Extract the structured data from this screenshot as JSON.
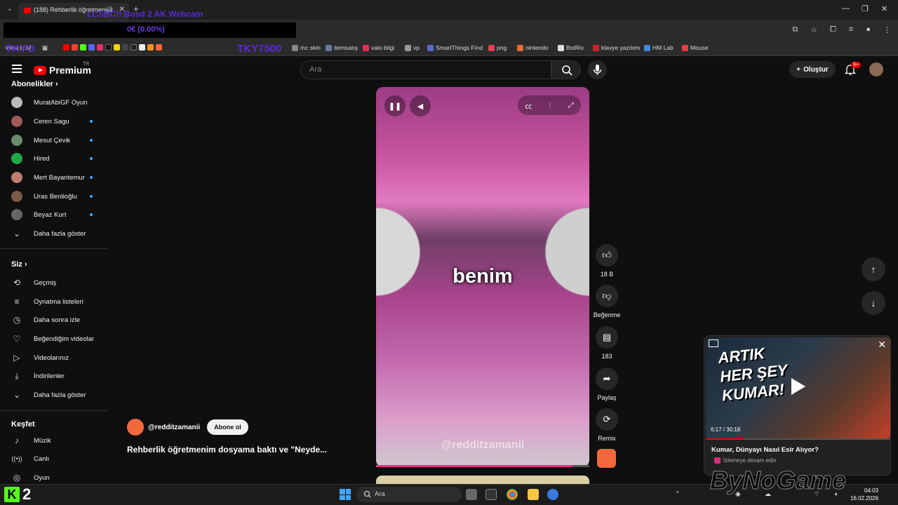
{
  "browser": {
    "tab_title": "(188) Rehberlik öğretmenim",
    "overlay_top_text": "LCSBC!! Bosd 2 AK Webcam",
    "blackbox_text": "0€ (0.00%)",
    "overlay_tags": [
      "TKYO",
      "TKY7500"
    ],
    "bookmarks": [
      {
        "label": "mc skin",
        "color": "#888"
      },
      {
        "label": "itemsatış",
        "color": "#6a7aa0"
      },
      {
        "label": "valo bilgi",
        "color": "#e03050"
      },
      {
        "label": "vp",
        "color": "#999"
      },
      {
        "label": "SmartThings Find",
        "color": "#5a6ad0"
      },
      {
        "label": "png",
        "color": "#e04050"
      },
      {
        "label": "nintendo",
        "color": "#e07030"
      },
      {
        "label": "BotRix",
        "color": "#ddd"
      },
      {
        "label": "klavye yazılımı",
        "color": "#d02030"
      },
      {
        "label": "HM Lab",
        "color": "#3a8ae0"
      },
      {
        "label": "Mouse",
        "color": "#e04040"
      }
    ],
    "bookmark_first_label": "www.ts.hr"
  },
  "header": {
    "logo_text": "Premium",
    "logo_region": "TR",
    "search_placeholder": "Ara",
    "create_label": "Oluştur",
    "notifications_badge": "9+"
  },
  "sidebar": {
    "subscriptions_title": "Abonelikler",
    "subscriptions": [
      {
        "label": "MuratAbiGF Oyun",
        "color": "#bbb",
        "dot": false
      },
      {
        "label": "Ceren Sagu",
        "color": "#a05a5a",
        "dot": true
      },
      {
        "label": "Mesut Çevik",
        "color": "#6a8a6a",
        "dot": true
      },
      {
        "label": "Hired",
        "color": "#1faa4a",
        "dot": true
      },
      {
        "label": "Mert Bayantemur",
        "color": "#c08070",
        "dot": true
      },
      {
        "label": "Uras Benlioğlu",
        "color": "#7a5a4a",
        "dot": true
      },
      {
        "label": "Beyaz Kurt",
        "color": "#666",
        "dot": true
      }
    ],
    "subs_more": "Daha fazla göster",
    "you_title": "Siz",
    "you_items": [
      {
        "label": "Geçmiş",
        "icon": "history-icon",
        "glyph": "⟲"
      },
      {
        "label": "Oynatma listeleri",
        "icon": "playlist-icon",
        "glyph": "≡"
      },
      {
        "label": "Daha sonra izle",
        "icon": "clock-icon",
        "glyph": "◷"
      },
      {
        "label": "Beğendiğim videolar",
        "icon": "thumbs-up-icon",
        "glyph": "👍"
      },
      {
        "label": "Videolarınız",
        "icon": "video-icon",
        "glyph": "▷"
      },
      {
        "label": "İndirilenler",
        "icon": "download-icon",
        "glyph": "⤓"
      }
    ],
    "you_more": "Daha fazla göster",
    "explore_title": "Keşfet",
    "explore_items": [
      {
        "label": "Müzik",
        "icon": "music-icon",
        "glyph": "♪"
      },
      {
        "label": "Canlı",
        "icon": "live-icon",
        "glyph": "((•))"
      },
      {
        "label": "Oyun",
        "icon": "gaming-icon",
        "glyph": "🎮"
      }
    ]
  },
  "short": {
    "caption": "benim",
    "watermark": "@redditzamanii",
    "channel": "@redditzamanii",
    "subscribe_label": "Abone ol",
    "title": "Rehberlik öğretmenim dosyama baktı ve \"Neyde...",
    "progress": 0.92,
    "likes": "18 B",
    "dislike_label": "Beğenme",
    "comments": "183",
    "share_label": "Paylaş",
    "remix_label": "Remix"
  },
  "miniplayer": {
    "thumb_text": "ARTIK HER ŞEY KUMAR!",
    "time": "6:17 / 30:18",
    "progress": 0.207,
    "title": "Kumar, Dünyayı Nasıl Esir Alıyor?",
    "channel": "İzlemeye devam edin"
  },
  "taskbar": {
    "k2_label": "2",
    "search_label": "Ara",
    "watermark": "ByNoGame",
    "time": "04:03",
    "date": "16.02.2026"
  }
}
